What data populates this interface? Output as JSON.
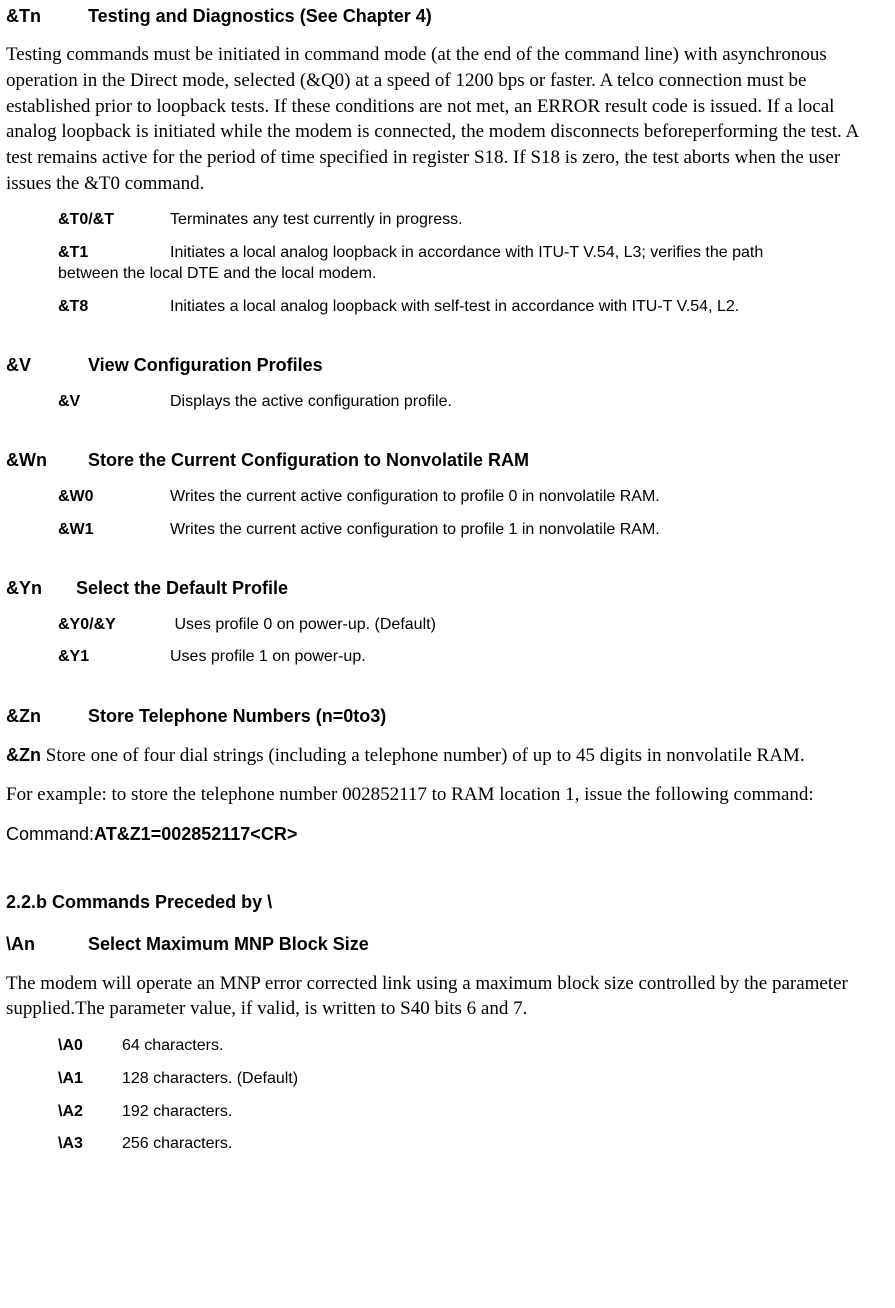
{
  "tn": {
    "cmd": "&Tn",
    "title": "Testing and Diagnostics (See Chapter 4)",
    "para": "Testing commands must be initiated in command mode (at the end of the command line) with asynchronous operation in the Direct mode, selected (&Q0) at a speed of 1200 bps or faster. A telco connection must be established prior to loopback tests. If these conditions are not met, an ERROR result code is issued. If a local analog loopback is initiated while the modem is connected, the modem disconnects beforeperforming the test. A test remains active for the period of time specified in register S18. If S18 is zero, the test aborts when the user issues the &T0 command.",
    "items": [
      {
        "cmd": "&T0/&T",
        "desc": "Terminates any test currently in progress."
      },
      {
        "cmd": "&T1",
        "desc_a": "Initiates a local analog loopback in accordance with ITU-T V.54, L3; verifies the path",
        "desc_b": "between the local DTE and the local modem."
      },
      {
        "cmd": "&T8",
        "desc": "Initiates a local analog loopback with self-test in accordance with ITU-T V.54, L2."
      }
    ]
  },
  "v": {
    "cmd": "&V",
    "title": "View Configuration Profiles",
    "items": [
      {
        "cmd": "&V",
        "desc": "Displays the active configuration profile."
      }
    ]
  },
  "wn": {
    "cmd": "&Wn",
    "title": "Store the Current Configuration to Nonvolatile RAM",
    "items": [
      {
        "cmd": "&W0",
        "desc": "Writes the current active configuration to profile 0 in nonvolatile RAM."
      },
      {
        "cmd": "&W1",
        "desc": "Writes the current active configuration to profile 1 in nonvolatile RAM."
      }
    ]
  },
  "yn": {
    "cmd": "&Yn",
    "title": "Select the Default Profile",
    "items": [
      {
        "cmd": "&Y0/&Y",
        "desc": " Uses profile 0 on power-up. (Default)"
      },
      {
        "cmd": "&Y1",
        "desc": "Uses profile 1 on power-up."
      }
    ]
  },
  "zn": {
    "cmd": "&Zn",
    "title": "Store Telephone Numbers (n=0to3)",
    "para1_a": "&Zn",
    "para1_b": " Store one of four dial strings (including a telephone number) of up to 45 digits in nonvolatile RAM.",
    "para2": "For example: to store the telephone number 002852117 to RAM location 1, issue the following command:",
    "cmdline_a": "Command:",
    "cmdline_b": "AT&Z1=002852117<CR>"
  },
  "sec": {
    "title": "2.2.b   Commands Preceded by \\"
  },
  "an": {
    "cmd": "\\An",
    "title": "Select Maximum MNP Block Size",
    "para": "The modem will operate an MNP error corrected link using a maximum block size controlled by the parameter supplied.The parameter value, if valid, is written to S40 bits 6 and 7.",
    "items": [
      {
        "cmd": "\\A0",
        "desc": "64 characters."
      },
      {
        "cmd": "\\A1",
        "desc": "128 characters. (Default)"
      },
      {
        "cmd": "\\A2",
        "desc": "192 characters."
      },
      {
        "cmd": "\\A3",
        "desc": "256 characters."
      }
    ]
  }
}
